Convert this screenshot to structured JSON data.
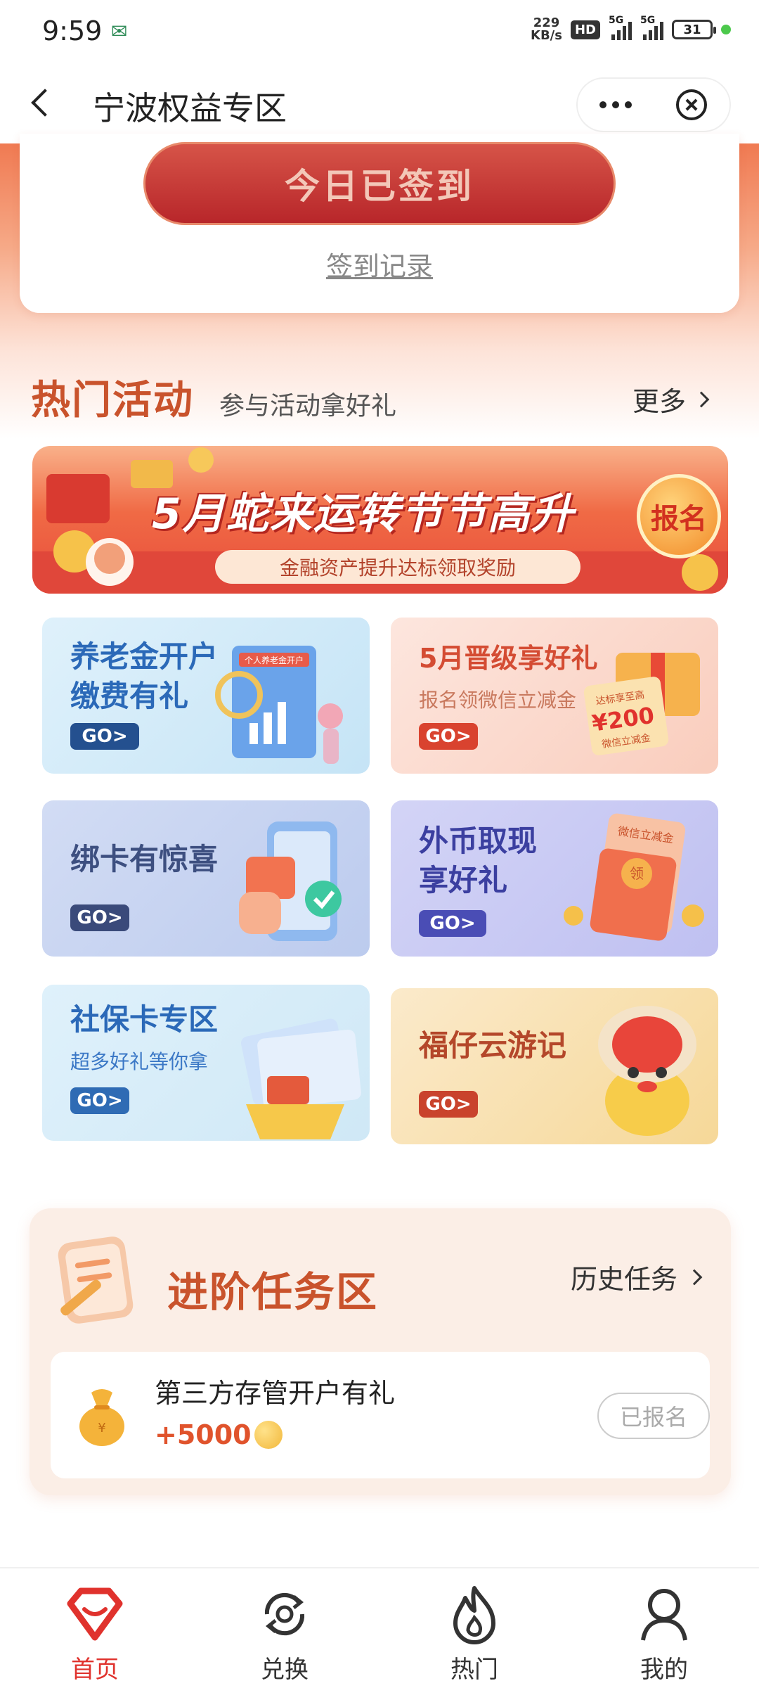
{
  "status_bar": {
    "time": "9:59",
    "carrier_icon": "china-post-icon",
    "net_speed_top": "229",
    "net_speed_bottom": "KB/s",
    "hd_label": "HD",
    "net1": "5G",
    "net2": "5G",
    "battery": "31"
  },
  "header": {
    "title": "宁波权益专区"
  },
  "signin": {
    "button_label": "今日已签到",
    "record_link": "签到记录"
  },
  "hot": {
    "title": "热门活动",
    "subtitle": "参与活动拿好礼",
    "more_label": "更多"
  },
  "banner": {
    "title": "5月蛇来运转节节高升",
    "subtitle": "金融资产提升达标领取奖励",
    "badge": "报名"
  },
  "cards": [
    {
      "title_line1": "养老金开户",
      "title_line2": "缴费有礼",
      "go": "GO>",
      "color": "#2b69b8",
      "deco_text": "个人养老金开户"
    },
    {
      "title_line1": "5月晋级享好礼",
      "sub": "报名领微信立减金",
      "go": "GO>",
      "color": "#d44c33",
      "deco_amount": "¥200",
      "deco_top": "达标享至高",
      "deco_bottom": "微信立减金"
    },
    {
      "title_line1": "绑卡有惊喜",
      "go": "GO>",
      "color": "#3d4f80"
    },
    {
      "title_line1": "外币取现",
      "title_line2": "享好礼",
      "go": "GO>",
      "color": "#3b3fa0",
      "deco_text": "微信立减金",
      "deco_seal": "领"
    },
    {
      "title_line1": "社保卡专区",
      "sub": "超多好礼等你拿",
      "go": "GO>",
      "color": "#2b69b8"
    },
    {
      "title_line1": "福仔云游记",
      "go": "GO>",
      "color": "#b4472a"
    }
  ],
  "tasks": {
    "title": "进阶任务区",
    "history_label": "历史任务",
    "item": {
      "name": "第三方存管开户有礼",
      "reward": "+5000",
      "button": "已报名"
    }
  },
  "nav": [
    {
      "label": "首页",
      "icon": "home-gem-icon",
      "active": true
    },
    {
      "label": "兑换",
      "icon": "exchange-icon",
      "active": false
    },
    {
      "label": "热门",
      "icon": "flame-icon",
      "active": false
    },
    {
      "label": "我的",
      "icon": "person-icon",
      "active": false
    }
  ],
  "colors": {
    "accent": "#e0322d",
    "section_title": "#c9532c",
    "signin_button": "#b8262a"
  }
}
